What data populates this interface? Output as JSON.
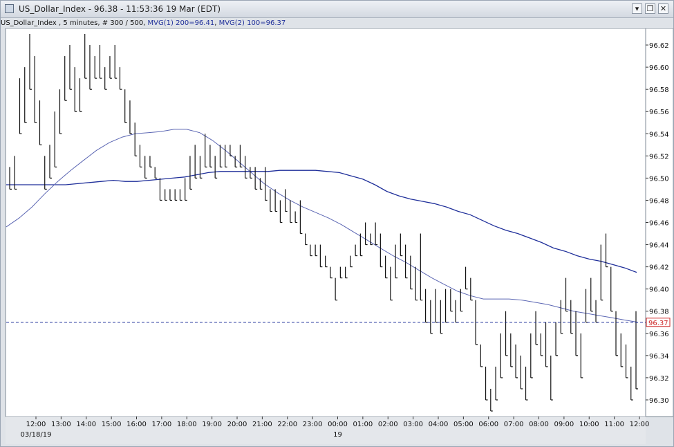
{
  "window": {
    "title": "US_Dollar_Index - 96.38 - 11:53:36  19 Mar (EDT)",
    "icons": [
      "app-icon",
      "pin-icon",
      "restore-icon",
      "close-icon"
    ]
  },
  "infobar": {
    "symbol": "US_Dollar_Index , 5 minutes, # 300 / 500, ",
    "mvg1": "MVG(1) 200=96.41",
    "sep": ", ",
    "mvg2": "MVG(2) 100=96.37",
    "mvg_color": "#1f2f9a"
  },
  "chart_data": {
    "type": "line",
    "title": "",
    "xlabel": "",
    "ylabel": "",
    "ylim": [
      96.285,
      96.635
    ],
    "y_ticks": [
      "96.62",
      "96.60",
      "96.58",
      "96.56",
      "96.54",
      "96.52",
      "96.50",
      "96.48",
      "96.46",
      "96.44",
      "96.42",
      "96.40",
      "96.38",
      "96.36",
      "96.34",
      "96.32",
      "96.30"
    ],
    "x_ticks": [
      "12:00",
      "13:00",
      "14:00",
      "15:00",
      "16:00",
      "17:00",
      "18:00",
      "19:00",
      "20:00",
      "21:00",
      "22:00",
      "23:00",
      "00:00",
      "01:00",
      "02:00",
      "03:00",
      "04:00",
      "05:00",
      "06:00",
      "07:00",
      "08:00",
      "09:00",
      "10:00",
      "11:00",
      "12:00"
    ],
    "date_labels": [
      {
        "text": "03/18/19",
        "tick": 0
      },
      {
        "text": "19",
        "tick": 12
      }
    ],
    "last_price": 96.37,
    "last_price_label": "96.37",
    "colors": {
      "price": "#111111",
      "mvg1": "#1f2f9a",
      "mvg2": "#5b66b3",
      "last": "#1f2f9a",
      "last_label": "#cc2222"
    },
    "price_bars": [
      [
        96.51,
        96.49
      ],
      [
        96.52,
        96.49
      ],
      [
        96.59,
        96.54
      ],
      [
        96.6,
        96.55
      ],
      [
        96.63,
        96.58
      ],
      [
        96.61,
        96.55
      ],
      [
        96.57,
        96.53
      ],
      [
        96.52,
        96.49
      ],
      [
        96.53,
        96.5
      ],
      [
        96.56,
        96.51
      ],
      [
        96.58,
        96.54
      ],
      [
        96.61,
        96.57
      ],
      [
        96.62,
        96.58
      ],
      [
        96.6,
        96.56
      ],
      [
        96.59,
        96.56
      ],
      [
        96.63,
        96.59
      ],
      [
        96.62,
        96.58
      ],
      [
        96.61,
        96.59
      ],
      [
        96.62,
        96.59
      ],
      [
        96.6,
        96.58
      ],
      [
        96.61,
        96.59
      ],
      [
        96.62,
        96.59
      ],
      [
        96.6,
        96.58
      ],
      [
        96.58,
        96.55
      ],
      [
        96.57,
        96.54
      ],
      [
        96.55,
        96.52
      ],
      [
        96.53,
        96.51
      ],
      [
        96.52,
        96.5
      ],
      [
        96.52,
        96.51
      ],
      [
        96.51,
        96.5
      ],
      [
        96.5,
        96.48
      ],
      [
        96.49,
        96.48
      ],
      [
        96.49,
        96.48
      ],
      [
        96.49,
        96.48
      ],
      [
        96.49,
        96.48
      ],
      [
        96.5,
        96.48
      ],
      [
        96.52,
        96.49
      ],
      [
        96.53,
        96.5
      ],
      [
        96.52,
        96.5
      ],
      [
        96.54,
        96.51
      ],
      [
        96.53,
        96.51
      ],
      [
        96.52,
        96.5
      ],
      [
        96.53,
        96.51
      ],
      [
        96.53,
        96.51
      ],
      [
        96.53,
        96.52
      ],
      [
        96.52,
        96.51
      ],
      [
        96.53,
        96.51
      ],
      [
        96.52,
        96.5
      ],
      [
        96.51,
        96.5
      ],
      [
        96.51,
        96.49
      ],
      [
        96.5,
        96.49
      ],
      [
        96.51,
        96.48
      ],
      [
        96.49,
        96.47
      ],
      [
        96.49,
        96.47
      ],
      [
        96.48,
        96.46
      ],
      [
        96.49,
        96.47
      ],
      [
        96.48,
        96.46
      ],
      [
        96.47,
        96.46
      ],
      [
        96.48,
        96.45
      ],
      [
        96.45,
        96.44
      ],
      [
        96.44,
        96.43
      ],
      [
        96.44,
        96.43
      ],
      [
        96.44,
        96.42
      ],
      [
        96.43,
        96.42
      ],
      [
        96.42,
        96.41
      ],
      [
        96.41,
        96.39
      ],
      [
        96.42,
        96.41
      ],
      [
        96.42,
        96.41
      ],
      [
        96.43,
        96.42
      ],
      [
        96.44,
        96.43
      ],
      [
        96.45,
        96.43
      ],
      [
        96.46,
        96.44
      ],
      [
        96.45,
        96.44
      ],
      [
        96.46,
        96.44
      ],
      [
        96.45,
        96.42
      ],
      [
        96.43,
        96.41
      ],
      [
        96.42,
        96.39
      ],
      [
        96.44,
        96.41
      ],
      [
        96.45,
        96.43
      ],
      [
        96.44,
        96.41
      ],
      [
        96.43,
        96.4
      ],
      [
        96.42,
        96.39
      ],
      [
        96.45,
        96.39
      ],
      [
        96.4,
        96.37
      ],
      [
        96.39,
        96.36
      ],
      [
        96.4,
        96.37
      ],
      [
        96.39,
        96.36
      ],
      [
        96.4,
        96.37
      ],
      [
        96.4,
        96.38
      ],
      [
        96.39,
        96.37
      ],
      [
        96.4,
        96.38
      ],
      [
        96.42,
        96.4
      ],
      [
        96.41,
        96.39
      ],
      [
        96.39,
        96.35
      ],
      [
        96.35,
        96.33
      ],
      [
        96.33,
        96.3
      ],
      [
        96.31,
        96.29
      ],
      [
        96.33,
        96.3
      ],
      [
        96.36,
        96.32
      ],
      [
        96.38,
        96.34
      ],
      [
        96.36,
        96.33
      ],
      [
        96.35,
        96.32
      ],
      [
        96.34,
        96.31
      ],
      [
        96.33,
        96.3
      ],
      [
        96.36,
        96.32
      ],
      [
        96.38,
        96.35
      ],
      [
        96.36,
        96.34
      ],
      [
        96.37,
        96.33
      ],
      [
        96.34,
        96.3
      ],
      [
        96.37,
        96.34
      ],
      [
        96.39,
        96.36
      ],
      [
        96.41,
        96.38
      ],
      [
        96.39,
        96.36
      ],
      [
        96.38,
        96.34
      ],
      [
        96.36,
        96.32
      ],
      [
        96.4,
        96.37
      ],
      [
        96.41,
        96.38
      ],
      [
        96.39,
        96.37
      ],
      [
        96.44,
        96.39
      ],
      [
        96.45,
        96.42
      ],
      [
        96.42,
        96.38
      ],
      [
        96.38,
        96.34
      ],
      [
        96.36,
        96.33
      ],
      [
        96.35,
        96.32
      ],
      [
        96.33,
        96.3
      ],
      [
        96.38,
        96.31
      ]
    ],
    "series": [
      {
        "name": "MVG(1) 200",
        "values": [
          96.494,
          96.494,
          96.494,
          96.494,
          96.494,
          96.494,
          96.495,
          96.496,
          96.497,
          96.498,
          96.497,
          96.497,
          96.498,
          96.499,
          96.5,
          96.501,
          96.503,
          96.505,
          96.506,
          96.506,
          96.506,
          96.506,
          96.506,
          96.507,
          96.507,
          96.507,
          96.507,
          96.506,
          96.505,
          96.502,
          96.499,
          96.494,
          96.488,
          96.484,
          96.481,
          96.479,
          96.477,
          96.474,
          96.47,
          96.467,
          96.462,
          96.457,
          96.453,
          96.45,
          96.446,
          96.442,
          96.437,
          96.434,
          96.43,
          96.427,
          96.425,
          96.422,
          96.419,
          96.415
        ]
      },
      {
        "name": "MVG(2) 100",
        "values": [
          96.456,
          96.464,
          96.474,
          96.486,
          96.497,
          96.507,
          96.516,
          96.525,
          96.532,
          96.537,
          96.54,
          96.541,
          96.542,
          96.544,
          96.544,
          96.541,
          96.534,
          96.525,
          96.515,
          96.505,
          96.495,
          96.487,
          96.48,
          96.474,
          96.469,
          96.464,
          96.458,
          96.451,
          96.444,
          96.437,
          96.43,
          96.424,
          96.417,
          96.41,
          96.404,
          96.398,
          96.394,
          96.391,
          96.391,
          96.391,
          96.39,
          96.388,
          96.386,
          96.383,
          96.38,
          96.378,
          96.376,
          96.374,
          96.372,
          96.37
        ]
      }
    ]
  }
}
